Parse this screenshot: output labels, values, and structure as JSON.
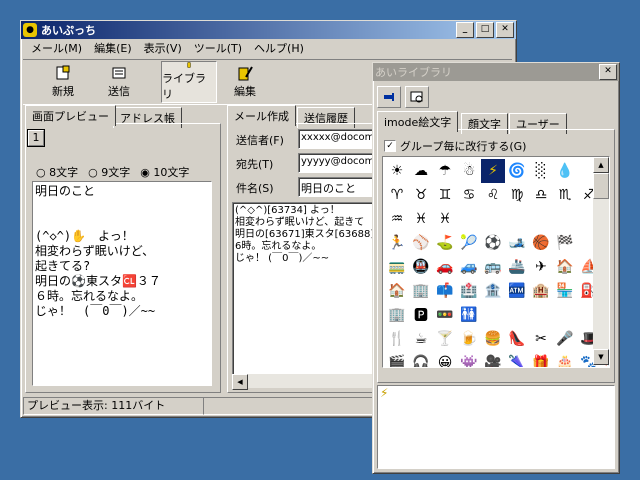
{
  "main_window": {
    "title": "あいぷっち",
    "title_icon": "app-icon",
    "menu": [
      "メール(M)",
      "編集(E)",
      "表示(V)",
      "ツール(T)",
      "ヘルプ(H)"
    ],
    "toolbar": {
      "new_label": "新規",
      "send_label": "送信",
      "library_label": "ライブラリ",
      "edit_label": "編集"
    },
    "left_tabs": [
      "画面プレビュー",
      "アドレス帳"
    ],
    "page_number": "1",
    "char_options": [
      "8文字",
      "9文字",
      "10文字"
    ],
    "selected_char_option": "10文字",
    "preview_lines": [
      "明日のこと",
      "",
      "",
      "(^◇^)✋　よっ！",
      "相変わらず眠いけど、",
      "起きてる?",
      "明日の⚽東スタ🆑３７",
      "６時。忘れるなよ。",
      "じゃ！　(￣0￣)／~~"
    ],
    "right_tabs": [
      "メール作成",
      "送信履歴"
    ],
    "sender_label": "送信者(F)",
    "sender_value": "xxxxx@docomo",
    "to_label": "宛先(T)",
    "to_value": "yyyyy@docomo",
    "subject_label": "件名(S)",
    "subject_value": "明日のこと",
    "body_lines": [
      "(^◇^)[63734]  よっ！",
      "相変わらず眠いけど、起きて",
      "明日の[63671]東スタ[63688]",
      "6時。忘れるなよ。",
      "じゃ！ (￣0￣)／~~"
    ],
    "status_text": "プレビュー表示: 111バイト"
  },
  "library_window": {
    "title": "あいライブラリ",
    "tabs": [
      "imode絵文字",
      "顔文字",
      "ユーザー"
    ],
    "checkbox_label": "グループ毎に改行する(G)",
    "checkbox_checked": true,
    "emoji_rows": [
      [
        "☀",
        "☁",
        "☂",
        "☃",
        "⚡",
        "🌀",
        "░",
        "💧",
        "",
        ""
      ],
      [
        "♈",
        "♉",
        "♊",
        "♋",
        "♌",
        "♍",
        "♎",
        "♏",
        "♐",
        "♑"
      ],
      [
        "♒",
        "♓",
        "♓",
        "",
        "",
        "",
        "",
        "",
        "",
        ""
      ],
      [
        "🏃",
        "⚾",
        "⛳",
        "🎾",
        "⚽",
        "🎿",
        "🏀",
        "🏁",
        "",
        ""
      ],
      [
        "🚃",
        "🚇",
        "🚗",
        "🚙",
        "🚌",
        "🚢",
        "✈",
        "🏠",
        "⛵",
        "🏢"
      ],
      [
        "🏠",
        "🏢",
        "📫",
        "🏥",
        "🏦",
        "🏧",
        "🏨",
        "🏪",
        "⛽",
        "🅿"
      ],
      [
        "🏢",
        "🅿",
        "🚥",
        "🚻",
        "",
        "",
        "",
        "",
        "",
        ""
      ],
      [
        "🍴",
        "☕",
        "🍸",
        "🍺",
        "🍔",
        "👠",
        "✂",
        "🎤",
        "🎩",
        "🎸"
      ],
      [
        "🎬",
        "🎧",
        "😀",
        "👾",
        "🎥",
        "🌂",
        "🎁",
        "🎂",
        "🐾",
        "🎭"
      ]
    ],
    "selected_preview": "⚡"
  }
}
